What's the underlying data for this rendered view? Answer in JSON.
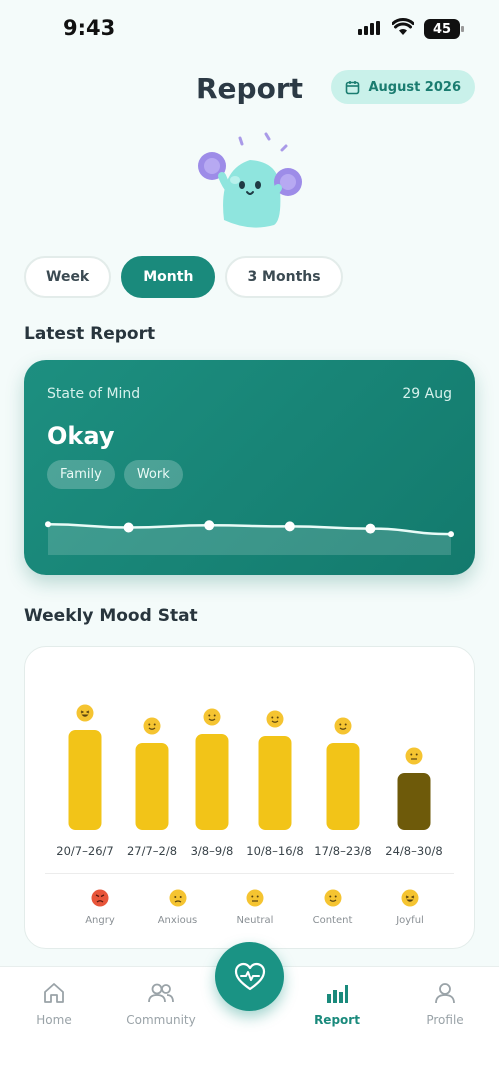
{
  "status_bar": {
    "time": "9:43",
    "battery": "45"
  },
  "header": {
    "title": "Report",
    "date_filter": "August 2026"
  },
  "tabs": [
    {
      "label": "Week",
      "active": false
    },
    {
      "label": "Month",
      "active": true
    },
    {
      "label": "3 Months",
      "active": false
    }
  ],
  "latest_report": {
    "section_title": "Latest Report",
    "label": "State of Mind",
    "date": "29 Aug",
    "state": "Okay",
    "tags": [
      "Family",
      "Work"
    ]
  },
  "weekly_mood": {
    "section_title": "Weekly Mood Stat",
    "legend": [
      {
        "label": "Angry",
        "icon": "angry-face-icon"
      },
      {
        "label": "Anxious",
        "icon": "anxious-face-icon"
      },
      {
        "label": "Neutral",
        "icon": "neutral-face-icon"
      },
      {
        "label": "Content",
        "icon": "content-face-icon"
      },
      {
        "label": "Joyful",
        "icon": "joyful-face-icon"
      }
    ]
  },
  "chart_data": [
    {
      "type": "line",
      "title": "",
      "x": [
        1,
        2,
        3,
        4,
        5,
        6
      ],
      "series": [
        {
          "values": [
            0.56,
            0.5,
            0.54,
            0.52,
            0.48,
            0.38
          ]
        }
      ],
      "ylim": [
        0,
        1
      ],
      "grid": false
    },
    {
      "type": "bar",
      "title": "",
      "categories": [
        "20/7–26/7",
        "27/7–2/8",
        "3/8–9/8",
        "10/8–16/8",
        "17/8–23/8",
        "24/8–30/8"
      ],
      "values": [
        100,
        87,
        96,
        94,
        87,
        57
      ],
      "moods": [
        "Joyful",
        "Content",
        "Content",
        "Content",
        "Content",
        "Neutral"
      ],
      "colors": [
        "#f2c418",
        "#f2c418",
        "#f2c418",
        "#f2c418",
        "#f2c418",
        "#6e5a0a"
      ],
      "ylim": [
        0,
        100
      ],
      "grid": false
    }
  ],
  "bottom_nav": [
    {
      "label": "Home",
      "icon": "home-icon",
      "active": false
    },
    {
      "label": "Community",
      "icon": "community-icon",
      "active": false
    },
    {
      "label": "Report",
      "icon": "bar-chart-icon",
      "active": true
    },
    {
      "label": "Profile",
      "icon": "profile-icon",
      "active": false
    }
  ],
  "fab": {
    "icon": "heart-pulse-icon"
  },
  "colors": {
    "accent": "#1a8a7c",
    "bar": "#f2c418",
    "bar_selected": "#6e5a0a"
  }
}
